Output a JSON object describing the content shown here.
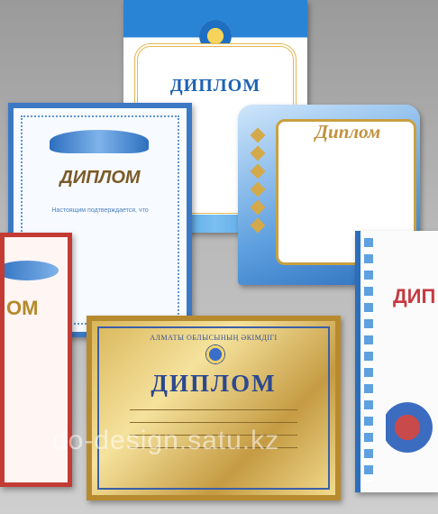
{
  "cards": {
    "top_blue": {
      "title": "ДИПЛОМ"
    },
    "left_white": {
      "title": "ДИПЛОМ",
      "subtitle": "Настоящим подтверждается, что"
    },
    "right_sport": {
      "title": "Диплом"
    },
    "left_red": {
      "title": "ОМ"
    },
    "right_white": {
      "title": "ДИП"
    },
    "bottom_gold": {
      "header": "АЛМАТЫ ОБЛЫСЫНЫҢ ӘКІМДІГІ",
      "title": "ДИПЛОМ"
    }
  },
  "watermark": "do-design.satu.kz",
  "colors": {
    "blue": "#2a84d6",
    "gold": "#d9b65a",
    "red": "#c23b34"
  }
}
